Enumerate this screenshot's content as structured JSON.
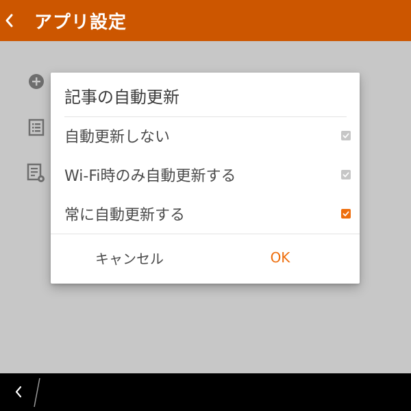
{
  "header": {
    "title": "アプリ設定",
    "background_color": "#cc5600"
  },
  "background_list": {
    "icons": [
      "add-circle-icon",
      "list-icon",
      "document-settings-icon"
    ]
  },
  "dialog": {
    "title": "記事の自動更新",
    "options": [
      {
        "label": "自動更新しない",
        "checked": false
      },
      {
        "label": "Wi-Fi時のみ自動更新する",
        "checked": false
      },
      {
        "label": "常に自動更新する",
        "checked": true
      }
    ],
    "cancel_label": "キャンセル",
    "ok_label": "OK",
    "accent_color": "#ee6e0d"
  },
  "nav_bar": {
    "icons": [
      "back-icon"
    ]
  }
}
